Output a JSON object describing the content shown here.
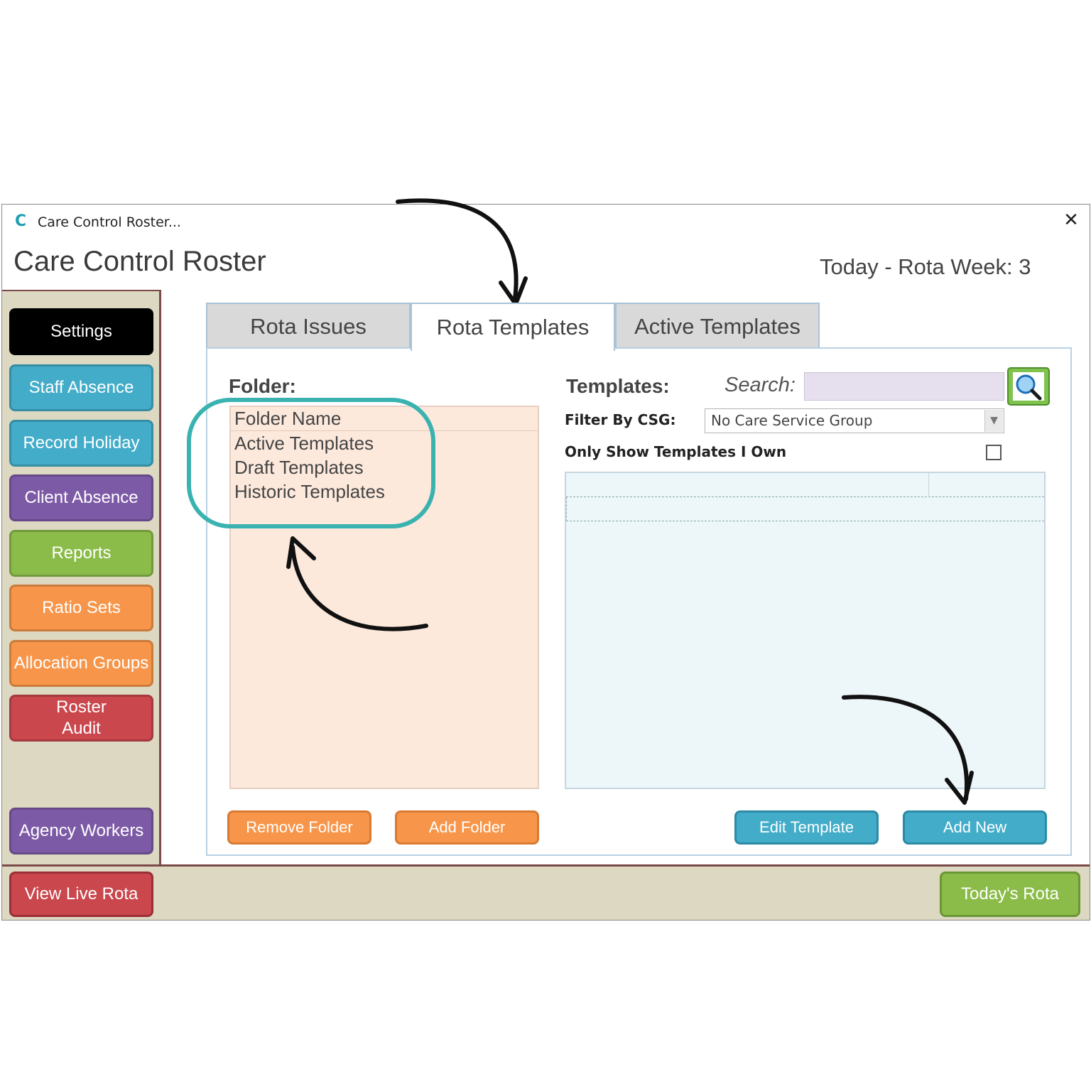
{
  "window": {
    "title": "Care Control Roster...",
    "app_title": "Care Control Roster",
    "rota_week": "Today - Rota Week: 3",
    "close_glyph": "✕"
  },
  "sidebar": {
    "items": [
      {
        "label": "Settings",
        "color": "#000000"
      },
      {
        "label": "Staff Absence",
        "color": "#42acc9"
      },
      {
        "label": "Record Holiday",
        "color": "#42acc9"
      },
      {
        "label": "Client Absence",
        "color": "#7d5aa6"
      },
      {
        "label": "Reports",
        "color": "#8bbc4a"
      },
      {
        "label": "Ratio Sets",
        "color": "#f7964a"
      },
      {
        "label": "Allocation Groups",
        "color": "#f7964a"
      },
      {
        "label": "Roster\nAudit",
        "color": "#c9474d"
      },
      {
        "label": "Agency Workers",
        "color": "#7d5aa6"
      }
    ]
  },
  "tabs": [
    {
      "label": "Rota Issues",
      "active": false
    },
    {
      "label": "Rota Templates",
      "active": true
    },
    {
      "label": "Active Templates",
      "active": false
    }
  ],
  "folders": {
    "label": "Folder:",
    "header": "Folder Name",
    "items": [
      "Active Templates",
      "Draft Templates",
      "Historic Templates"
    ]
  },
  "templates": {
    "label": "Templates:",
    "search_label": "Search:",
    "search_value": "",
    "filter_label": "Filter By CSG:",
    "filter_value": "No Care Service Group",
    "own_label": "Only Show Templates I Own",
    "own_checked": false
  },
  "buttons": {
    "remove_folder": "Remove Folder",
    "add_folder": "Add Folder",
    "edit_template": "Edit Template",
    "add_new": "Add New"
  },
  "footer": {
    "view_live_rota": "View Live Rota",
    "todays_rota": "Today's Rota"
  },
  "annotations": {
    "highlight_color": "#3ab3b0",
    "arrow_color": "#111111"
  }
}
